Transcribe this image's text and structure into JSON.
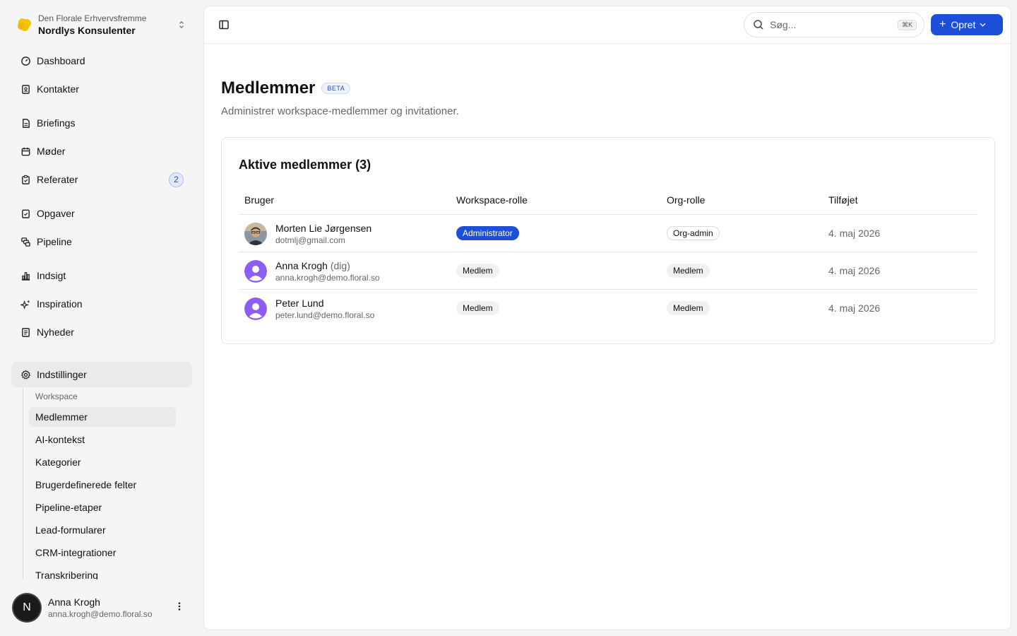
{
  "workspace": {
    "org": "Den Florale Erhvervsfremme",
    "name": "Nordlys Konsulenter"
  },
  "nav": {
    "items": [
      {
        "label": "Dashboard",
        "icon": "gauge-icon"
      },
      {
        "label": "Kontakter",
        "icon": "contacts-icon"
      },
      {
        "label": "Briefings",
        "icon": "document-icon"
      },
      {
        "label": "Møder",
        "icon": "calendar-icon"
      },
      {
        "label": "Referater",
        "icon": "clipboard-icon",
        "badge": "2"
      },
      {
        "label": "Opgaver",
        "icon": "checklist-icon"
      },
      {
        "label": "Pipeline",
        "icon": "pipeline-icon"
      },
      {
        "label": "Indsigt",
        "icon": "bar-chart-icon"
      },
      {
        "label": "Inspiration",
        "icon": "sparkles-icon"
      },
      {
        "label": "Nyheder",
        "icon": "newspaper-icon"
      },
      {
        "label": "Indstillinger",
        "icon": "gear-icon"
      }
    ],
    "settings_group": "Workspace",
    "settings_items": [
      "Medlemmer",
      "AI-kontekst",
      "Kategorier",
      "Brugerdefinerede felter",
      "Pipeline-etaper",
      "Lead-formularer",
      "CRM-integrationer",
      "Transkribering"
    ]
  },
  "current_user": {
    "initial": "N",
    "name": "Anna Krogh",
    "email": "anna.krogh@demo.floral.so"
  },
  "topbar": {
    "search_placeholder": "Søg...",
    "search_shortcut": "⌘K",
    "create_label": "Opret"
  },
  "page": {
    "title": "Medlemmer",
    "badge": "BETA",
    "subtitle": "Administrer workspace-medlemmer og invitationer."
  },
  "members": {
    "title": "Aktive medlemmer (3)",
    "columns": [
      "Bruger",
      "Workspace-rolle",
      "Org-rolle",
      "Tilføjet"
    ],
    "rows": [
      {
        "name": "Morten Lie Jørgensen",
        "suffix": "",
        "email": "dotmlj@gmail.com",
        "workspace_role": "Administrator",
        "org_role": "Org-admin",
        "added": "4. maj 2026"
      },
      {
        "name": "Anna Krogh",
        "suffix": "(dig)",
        "email": "anna.krogh@demo.floral.so",
        "workspace_role": "Medlem",
        "org_role": "Medlem",
        "added": "4. maj 2026"
      },
      {
        "name": "Peter Lund",
        "suffix": "",
        "email": "peter.lund@demo.floral.so",
        "workspace_role": "Medlem",
        "org_role": "Medlem",
        "added": "4. maj 2026"
      }
    ]
  },
  "colors": {
    "accent": "#1d4ed8",
    "avatar_purple": "#8b5cf6"
  }
}
